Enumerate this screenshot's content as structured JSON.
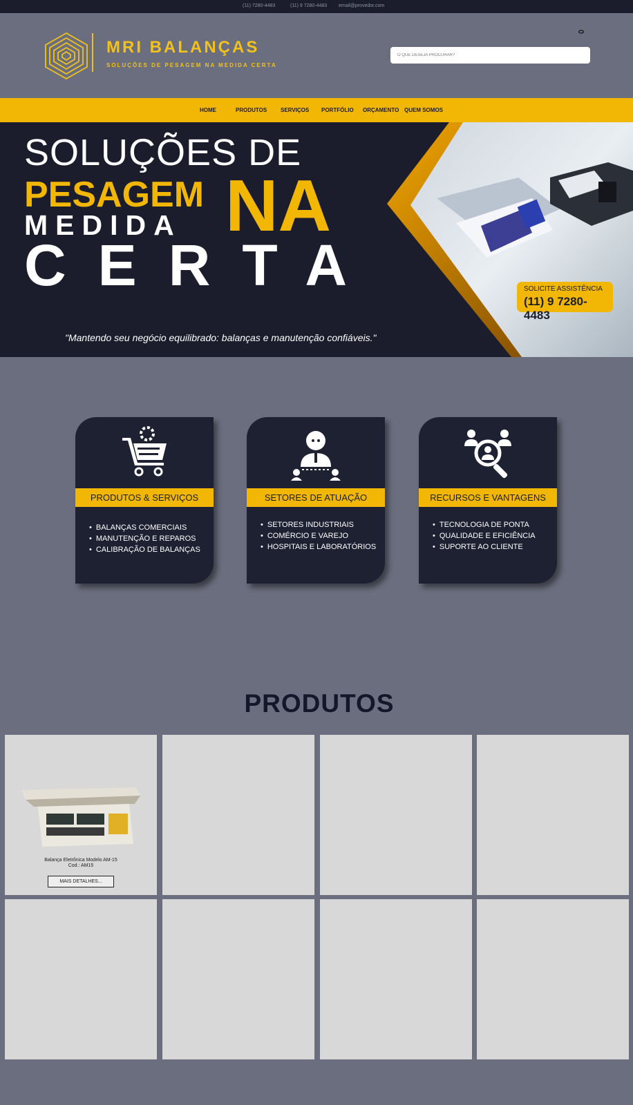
{
  "topbar": {
    "phone1": "(11)  7280-4483",
    "phone2": "(11) 9 7280-4483",
    "email": "email@provedor.com"
  },
  "header": {
    "brand_name": "MRI BALANÇAS",
    "brand_tagline": "SOLUÇÕES DE PESAGEM NA MEDIDA CERTA",
    "search_placeholder": "O QUE DESEJA PROCURAR?"
  },
  "nav": {
    "items": [
      "HOME",
      "PRODUTOS",
      "SERVIÇOS",
      "PORTFÓLIO",
      "ORÇAMENTO",
      "QUEM SOMOS"
    ]
  },
  "hero": {
    "line1": "SOLUÇÕES DE",
    "line2": "PESAGEM",
    "line3": "MEDIDA",
    "line_na": "NA",
    "line4": "CERTA",
    "assist_label": "SOLICITE ASSISTÊNCIA",
    "assist_phone": "(11) 9 7280-4483",
    "quote": "\"Mantendo seu negócio equilibrado: balanças e manutenção confiáveis.\""
  },
  "cards": [
    {
      "title": "PRODUTOS & SERVIÇOS",
      "icon": "cart-gear-icon",
      "items": [
        "BALANÇAS COMERCIAIS",
        "MANUTENÇÃO E REPAROS",
        "CALIBRAÇÃO DE BALANÇAS"
      ]
    },
    {
      "title": "SETORES DE ATUAÇÃO",
      "icon": "businessman-network-icon",
      "items": [
        "SETORES INDUSTRIAIS",
        "COMÉRCIO E VAREJO",
        "HOSPITAIS E LABORATÓRIOS"
      ]
    },
    {
      "title": "RECURSOS E VANTAGENS",
      "icon": "people-magnifier-icon",
      "items": [
        "TECNOLOGIA DE PONTA",
        "QUALIDADE E EFICIÊNCIA",
        "SUPORTE AO CLIENTE"
      ]
    }
  ],
  "products_section": {
    "title": "PRODUTOS",
    "first_product": {
      "name": "Balança Eletrônica Modelo AM-15",
      "code": "Cod.: AM15",
      "button": "MAIS DETALHES..."
    }
  },
  "colors": {
    "accent": "#f2b705",
    "dark": "#1b1d2c",
    "page_bg": "#6b6e7e",
    "card_bg": "#1e2132",
    "product_bg": "#d8d8d8"
  }
}
